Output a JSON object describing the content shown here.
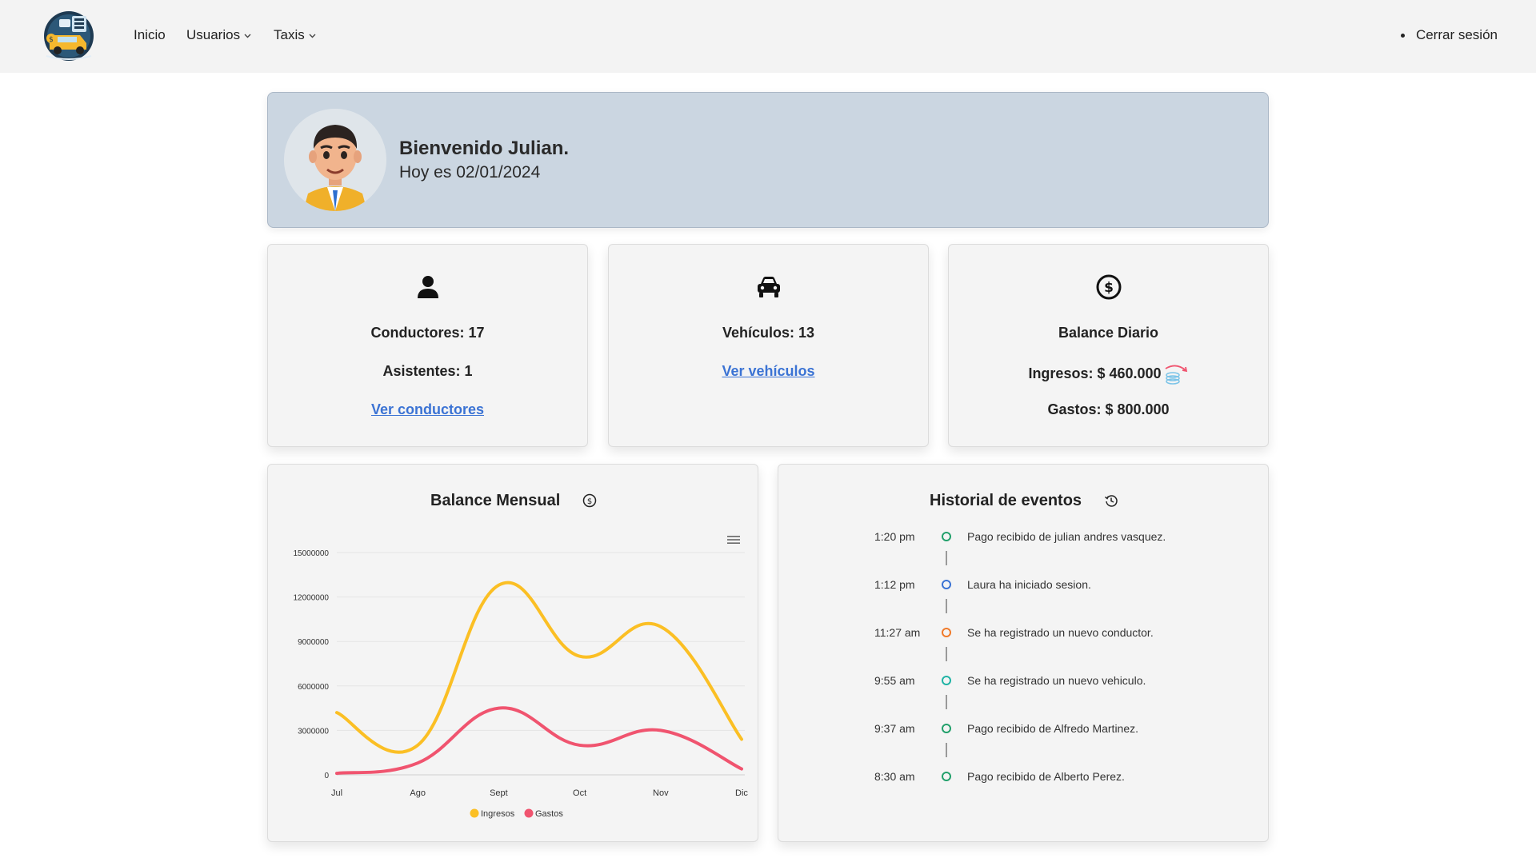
{
  "nav": {
    "items": [
      {
        "label": "Inicio"
      },
      {
        "label": "Usuarios"
      },
      {
        "label": "Taxis"
      }
    ],
    "logout_label": "Cerrar sesión"
  },
  "welcome": {
    "title": "Bienvenido Julian.",
    "date_text": "Hoy es 02/01/2024"
  },
  "stats": {
    "drivers": {
      "count_text": "Conductores: 17",
      "assistants_text": "Asistentes: 1",
      "link": "Ver conductores",
      "icon": "person-icon"
    },
    "vehicles": {
      "count_text": "Vehículos: 13",
      "link": "Ver vehículos",
      "icon": "car-icon"
    },
    "balance": {
      "title": "Balance Diario",
      "income_text": "Ingresos: $ 460.000",
      "expenses_text": "Gastos: $ 800.000",
      "icon": "dollar-circle-icon"
    }
  },
  "monthly": {
    "title": "Balance Mensual"
  },
  "chart_data": {
    "type": "line",
    "categories": [
      "Jul",
      "Ago",
      "Sept",
      "Oct",
      "Nov",
      "Dic"
    ],
    "ylim": [
      0,
      15000000
    ],
    "yticks": [
      "0",
      "3000000",
      "6000000",
      "9000000",
      "12000000",
      "15000000"
    ],
    "series": [
      {
        "name": "Ingresos",
        "color": "#fbbf24",
        "values": [
          4200000,
          2000000,
          12800000,
          8000000,
          10000000,
          2400000
        ]
      },
      {
        "name": "Gastos",
        "color": "#f0546f",
        "values": [
          100000,
          800000,
          4500000,
          2000000,
          3000000,
          400000
        ]
      }
    ],
    "smooth": true,
    "grid": true,
    "legend": "bottom-center"
  },
  "events": {
    "title": "Historial de eventos",
    "items": [
      {
        "time": "1:20 pm",
        "text": "Pago recibido de julian andres vasquez.",
        "color": "#22a06b"
      },
      {
        "time": "1:12 pm",
        "text": "Laura ha iniciado sesion.",
        "color": "#3b73d4"
      },
      {
        "time": "11:27 am",
        "text": "Se ha registrado un nuevo conductor.",
        "color": "#f07a2a"
      },
      {
        "time": "9:55 am",
        "text": "Se ha registrado un nuevo vehiculo.",
        "color": "#1fb3a5"
      },
      {
        "time": "9:37 am",
        "text": "Pago recibido de Alfredo Martinez.",
        "color": "#22a06b"
      },
      {
        "time": "8:30 am",
        "text": "Pago recibido de Alberto Perez.",
        "color": "#22a06b"
      }
    ]
  }
}
